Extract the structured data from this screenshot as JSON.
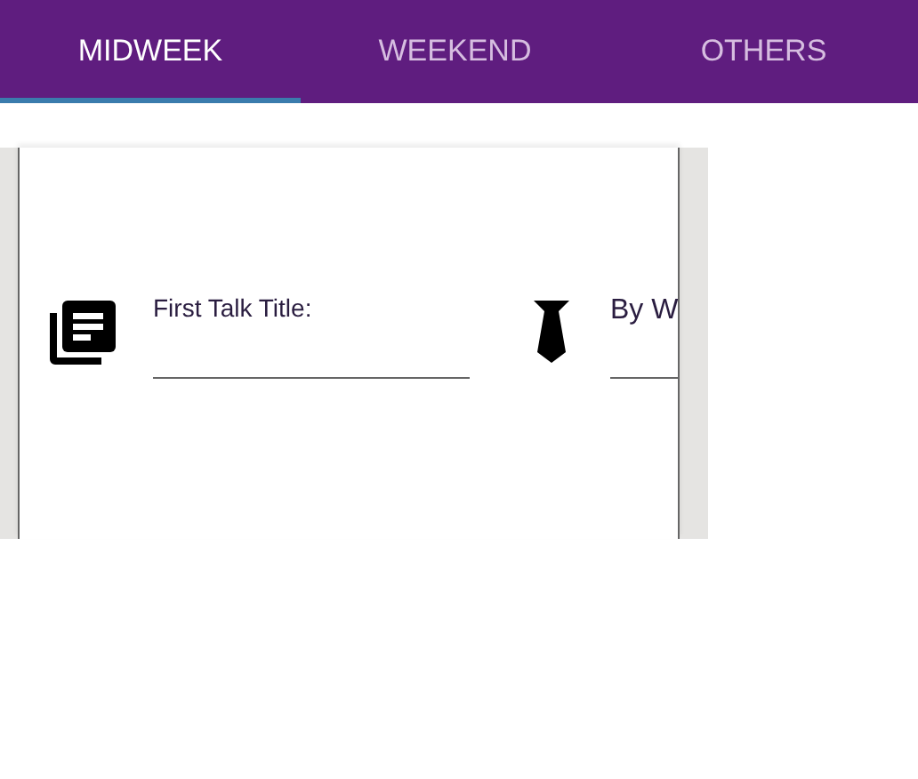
{
  "tabs": [
    {
      "label": "MIDWEEK",
      "selected": true
    },
    {
      "label": "WEEKEND",
      "selected": false
    },
    {
      "label": "OTHERS",
      "selected": false
    }
  ],
  "fields": [
    {
      "label": "First Talk Title:"
    },
    {
      "label": "By W"
    }
  ]
}
